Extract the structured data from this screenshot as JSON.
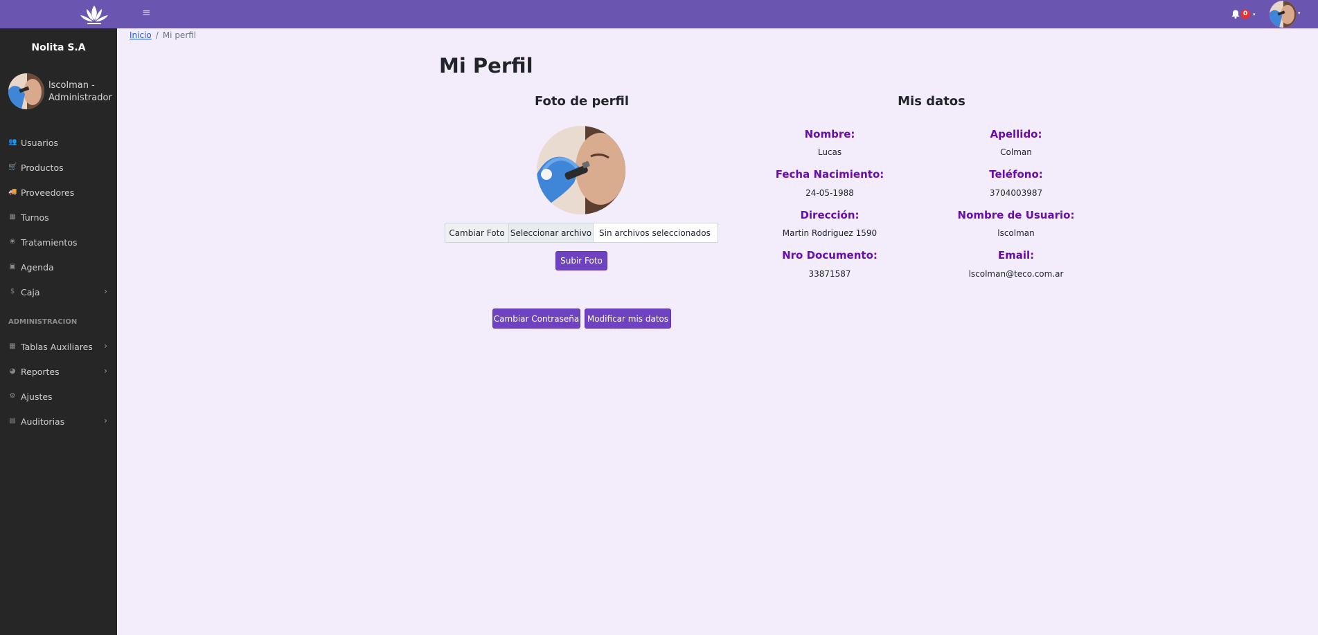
{
  "topbar": {
    "menu_glyph": "≡",
    "notifications_count": "0",
    "caret": "▾"
  },
  "sidebar": {
    "brand": "Nolita S.A",
    "user": "lscolman - Administrador",
    "items": [
      {
        "label": "Usuarios",
        "icon": "users-icon",
        "glyph": "👥"
      },
      {
        "label": "Productos",
        "icon": "cart-icon",
        "glyph": "🛒"
      },
      {
        "label": "Proveedores",
        "icon": "truck-icon",
        "glyph": "🚚"
      },
      {
        "label": "Turnos",
        "icon": "calendar-icon",
        "glyph": "▦"
      },
      {
        "label": "Tratamientos",
        "icon": "lotus-icon",
        "glyph": "❀"
      },
      {
        "label": "Agenda",
        "icon": "agenda-icon",
        "glyph": "▣"
      },
      {
        "label": "Caja",
        "icon": "dollar-icon",
        "glyph": "$"
      }
    ],
    "section_label": "ADMINISTRACION",
    "admin_items": [
      {
        "label": "Tablas Auxiliares",
        "icon": "table-icon",
        "glyph": "▦"
      },
      {
        "label": "Reportes",
        "icon": "chart-pie-icon",
        "glyph": "◕"
      },
      {
        "label": "Ajustes",
        "icon": "gear-icon",
        "glyph": "⚙"
      },
      {
        "label": "Auditorias",
        "icon": "book-icon",
        "glyph": "▤"
      }
    ],
    "chevron": "›"
  },
  "breadcrumb": {
    "home": "Inicio",
    "separator": "/",
    "current": "Mi perfil"
  },
  "page": {
    "title": "Mi Perfil",
    "photo_title": "Foto de perfil",
    "data_title": "Mis datos"
  },
  "file_input": {
    "label": "Cambiar Foto",
    "button": "Seleccionar archivo",
    "status": "Sin archivos seleccionados"
  },
  "buttons": {
    "upload": "Subir Foto",
    "change_password": "Cambiar Contraseña",
    "edit_data": "Modificar mis datos"
  },
  "fields": {
    "nombre_label": "Nombre:",
    "nombre": "Lucas",
    "apellido_label": "Apellido:",
    "apellido": "Colman",
    "fecha_label": "Fecha Nacimiento:",
    "fecha": "24-05-1988",
    "telefono_label": "Teléfono:",
    "telefono": "3704003987",
    "direccion_label": "Dirección:",
    "direccion": "Martin Rodriguez 1590",
    "usuario_label": "Nombre de Usuario:",
    "usuario": "lscolman",
    "documento_label": "Nro Documento:",
    "documento": "33871587",
    "email_label": "Email:",
    "email": "lscolman@teco.com.ar"
  },
  "colors": {
    "topbar": "#6a55b1",
    "sidebar": "#262626",
    "accent": "#6f42c1",
    "field_label": "#6a0dad",
    "background": "#f3ecfa"
  }
}
